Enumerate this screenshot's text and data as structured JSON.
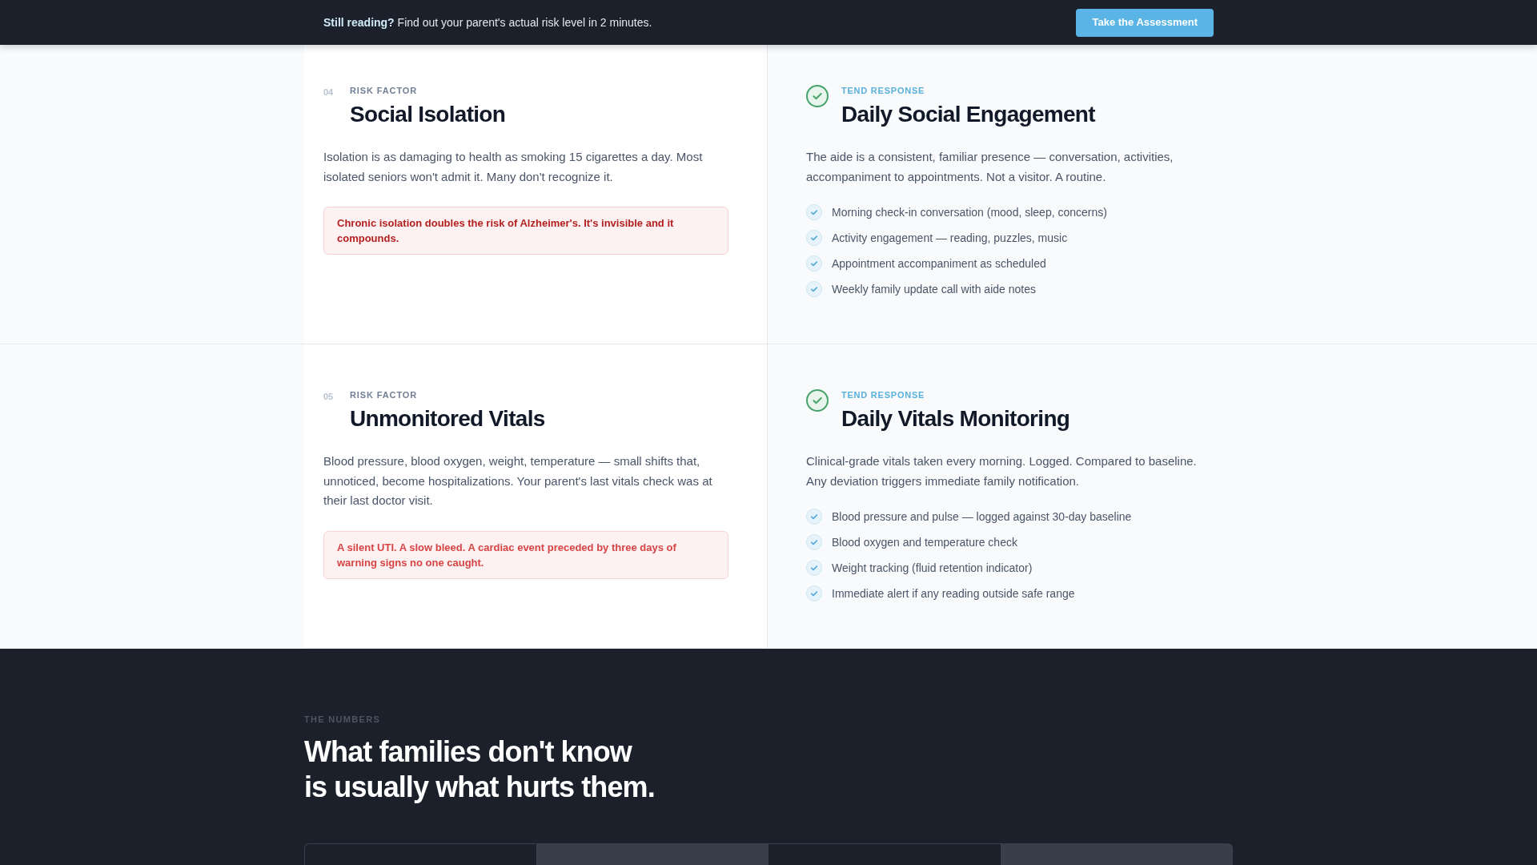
{
  "banner": {
    "message": "**Still reading?** Find out your parent's actual risk level in 2 minutes.",
    "button": "Take the Assessment"
  },
  "rows": [
    {
      "risk": {
        "number": "04",
        "label": "RISK FACTOR",
        "title": "Social Isolation",
        "body": "Isolation is as damaging to health as smoking 15 cigarettes a day. Most isolated seniors won't admit it. Many don't recognize it.",
        "callout": {
          "text": "Chronic isolation doubles the risk of Alzheimer's. It's invisible and it compounds.",
          "color": "#b31f1f"
        }
      },
      "response": {
        "label": "TEND RESPONSE",
        "title": "Daily Social Engagement",
        "body": "The aide is a consistent, familiar presence — conversation, activities, accompaniment to appointments. Not a visitor. A routine.",
        "items": [
          "Morning check-in conversation (mood, sleep, concerns)",
          "Activity engagement — reading, puzzles, music",
          "Appointment accompaniment as scheduled",
          "Weekly family update call with aide notes"
        ]
      }
    },
    {
      "risk": {
        "number": "05",
        "label": "RISK FACTOR",
        "title": "Unmonitored Vitals",
        "body": "Blood pressure, blood oxygen, weight, temperature — small shifts that, unnoticed, become hospitalizations. Your parent's last vitals check was at their last doctor visit.",
        "callout": {
          "text": "A silent UTI. A slow bleed. A cardiac event preceded by three days of warning signs no one caught.",
          "color": "#d64545"
        }
      },
      "response": {
        "label": "TEND RESPONSE",
        "title": "Daily Vitals Monitoring",
        "body": "Clinical-grade vitals taken every morning. Logged. Compared to baseline. Any deviation triggers immediate family notification.",
        "items": [
          "Blood pressure and pulse — logged against 30-day baseline",
          "Blood oxygen and temperature check",
          "Weight tracking (fluid retention indicator)",
          "Immediate alert if any reading outside safe range"
        ]
      }
    }
  ],
  "numbers": {
    "eyebrow": "THE NUMBERS",
    "heading": "What families don't know\nis usually what hurts them."
  }
}
